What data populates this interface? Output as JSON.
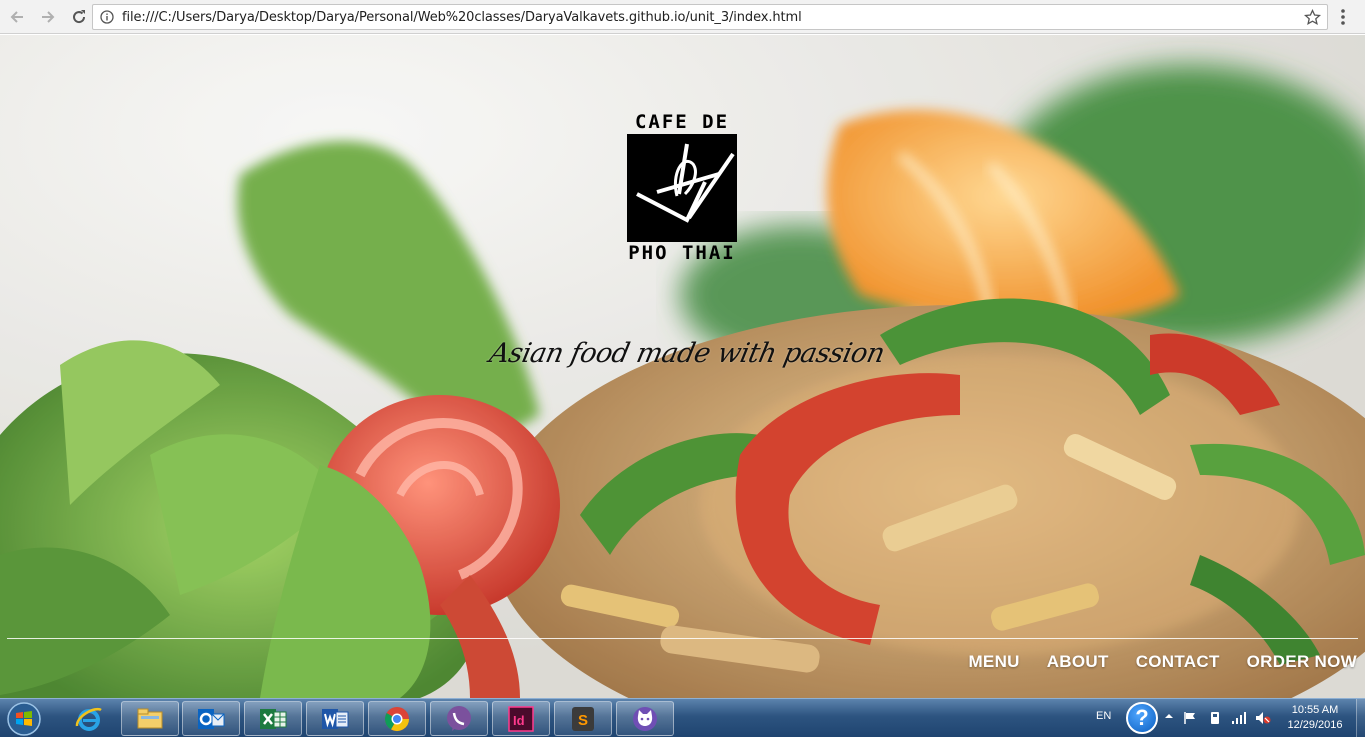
{
  "browser": {
    "url": "file:///C:/Users/Darya/Desktop/Darya/Personal/Web%20classes/DaryaValkavets.github.io/unit_3/index.html",
    "icons": [
      "back-arrow-icon",
      "forward-arrow-icon",
      "reload-icon",
      "info-icon",
      "star-icon",
      "menu-dots-icon"
    ]
  },
  "page": {
    "logo_top": "CAFE DE",
    "logo_bottom": "PHO THAI",
    "tagline": "Asian food made with passion",
    "nav": [
      "MENU",
      "ABOUT",
      "CONTACT",
      "ORDER NOW"
    ],
    "colors": {
      "nav_text": "#ffffff",
      "logo_box": "#000000",
      "tagline": "#111111"
    }
  },
  "taskbar": {
    "apps": [
      "internet-explorer-icon",
      "file-explorer-icon",
      "outlook-icon",
      "excel-icon",
      "word-icon",
      "chrome-icon",
      "viber-icon",
      "indesign-icon",
      "sublime-text-icon",
      "cat-app-icon"
    ],
    "tray": {
      "language": "EN",
      "help_glyph": "?",
      "time": "10:55 AM",
      "date": "12/29/2016"
    }
  }
}
